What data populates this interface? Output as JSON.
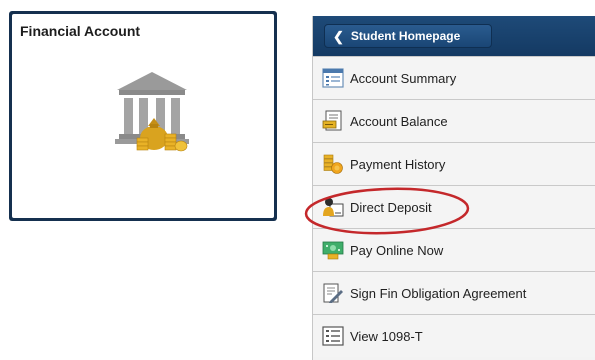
{
  "tile": {
    "title": "Financial Account",
    "icon": "bank-money-icon"
  },
  "nav": {
    "back_label": "Student Homepage",
    "items": [
      {
        "label": "Account Summary",
        "icon": "account-summary-icon"
      },
      {
        "label": "Account Balance",
        "icon": "account-balance-icon"
      },
      {
        "label": "Payment History",
        "icon": "payment-history-icon"
      },
      {
        "label": "Direct Deposit",
        "icon": "direct-deposit-icon"
      },
      {
        "label": "Pay Online Now",
        "icon": "pay-online-icon"
      },
      {
        "label": "Sign Fin Obligation Agreement",
        "icon": "sign-agreement-icon"
      },
      {
        "label": "View 1098-T",
        "icon": "view-form-icon"
      }
    ]
  },
  "annotation": {
    "highlighted_item": "Direct Deposit",
    "color": "#c4282b"
  },
  "colors": {
    "header": "#1a4270",
    "tile_border": "#15304f",
    "coin_gold": "#e9b227"
  }
}
